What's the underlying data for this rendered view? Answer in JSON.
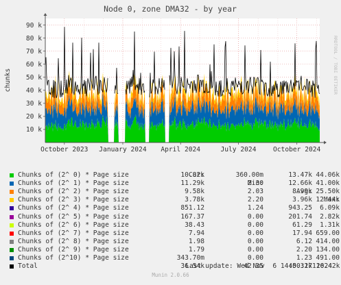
{
  "title": "Node 0, zone DMA32 - by year",
  "side_label": "RRDTOOL / TOBI OETIKER",
  "munin_version": "Munin 2.0.66",
  "colors": {
    "background": "#f0f0f0",
    "plot_bg": "#ffffff",
    "grid": "#e8a0a0",
    "axis": "#555555"
  },
  "legend": {
    "headers": {
      "cur": "Cur:",
      "min": "Min:",
      "avg": "Avg:",
      "max": "Max:"
    },
    "rows": [
      {
        "label": "Chunks of (2^ 0) * Page size",
        "color": "#00cc00",
        "cur": "10.82k",
        "min": "360.00m",
        "avg": "13.47k",
        "max": "44.06k"
      },
      {
        "label": "Chunks of (2^ 1) * Page size",
        "color": "#0066b3",
        "cur": "11.29k",
        "min": "2.30",
        "avg": "12.66k",
        "max": "41.00k"
      },
      {
        "label": "Chunks of (2^ 2) * Page size",
        "color": "#ff8000",
        "cur": "9.58k",
        "min": "2.03",
        "avg": "8.99k",
        "max": "25.50k"
      },
      {
        "label": "Chunks of (2^ 3) * Page size",
        "color": "#ffcc00",
        "cur": "3.78k",
        "min": "2.20",
        "avg": "3.96k",
        "max": "12.44k"
      },
      {
        "label": "Chunks of (2^ 4) * Page size",
        "color": "#330099",
        "cur": "851.12",
        "min": "1.24",
        "avg": "943.25",
        "max": "6.09k"
      },
      {
        "label": "Chunks of (2^ 5) * Page size",
        "color": "#990099",
        "cur": "167.37",
        "min": "0.00",
        "avg": "201.74",
        "max": "2.82k"
      },
      {
        "label": "Chunks of (2^ 6) * Page size",
        "color": "#ccff00",
        "cur": "38.43",
        "min": "0.00",
        "avg": "61.29",
        "max": "1.31k"
      },
      {
        "label": "Chunks of (2^ 7) * Page size",
        "color": "#ff0000",
        "cur": "7.94",
        "min": "0.00",
        "avg": "17.94",
        "max": "659.00"
      },
      {
        "label": "Chunks of (2^ 8) * Page size",
        "color": "#808080",
        "cur": "1.98",
        "min": "0.00",
        "avg": "6.12",
        "max": "414.00"
      },
      {
        "label": "Chunks of (2^ 9) * Page size",
        "color": "#008f00",
        "cur": "1.79",
        "min": "0.00",
        "avg": "2.20",
        "max": "134.00"
      },
      {
        "label": "Chunks of (2^10) * Page size",
        "color": "#00487d",
        "cur": "343.70m",
        "min": "0.00",
        "avg": "1.23",
        "max": "491.00"
      },
      {
        "label": "Total",
        "color": "#000000",
        "cur": "36.54k",
        "min": "42.35",
        "avg": "40.32k",
        "max": "116.42k"
      }
    ]
  },
  "last_update": "Last update: Wed Nov  6 14:50:17 2024",
  "chart_data": {
    "type": "area",
    "title": "Node 0, zone DMA32 - by year",
    "ylabel": "chunks",
    "ylim": [
      0,
      95000
    ],
    "y_ticks": [
      10000,
      20000,
      30000,
      40000,
      50000,
      60000,
      70000,
      80000,
      90000
    ],
    "y_tick_labels": [
      "10 k",
      "20 k",
      "30 k",
      "40 k",
      "50 k",
      "60 k",
      "70 k",
      "80 k",
      "90 k"
    ],
    "x_tick_labels": [
      "October 2023",
      "January 2024",
      "April 2024",
      "July 2024",
      "October 2024"
    ],
    "x_tick_dates": [
      "2023-10-01",
      "2024-01-01",
      "2024-04-01",
      "2024-07-01",
      "2024-10-01"
    ],
    "xlim": [
      "2023-09-01",
      "2024-11-06"
    ],
    "grid": true,
    "stacked": true,
    "series": [
      {
        "name": "Chunks of (2^ 0) * Page size",
        "x": [
          "2023-09-01",
          "2023-09-20",
          "2023-10-10",
          "2023-10-30",
          "2023-11-19",
          "2023-12-09",
          "2023-12-29",
          "2024-01-18",
          "2024-02-07",
          "2024-02-27",
          "2024-03-18",
          "2024-04-07",
          "2024-04-27",
          "2024-05-17",
          "2024-06-06",
          "2024-06-26",
          "2024-07-16",
          "2024-08-05",
          "2024-08-25",
          "2024-09-14",
          "2024-10-04",
          "2024-10-24",
          "2024-11-06"
        ],
        "y": [
          14000,
          12000,
          15000,
          13000,
          14500,
          16000,
          13000,
          15000,
          12500,
          14000,
          15500,
          14000,
          16000,
          15000,
          13500,
          14000,
          15500,
          14500,
          13000,
          14000,
          15000,
          13500,
          10820
        ]
      },
      {
        "name": "Chunks of (2^ 1) * Page size",
        "x": [
          "2023-09-01",
          "2023-09-20",
          "2023-10-10",
          "2023-10-30",
          "2023-11-19",
          "2023-12-09",
          "2023-12-29",
          "2024-01-18",
          "2024-02-07",
          "2024-02-27",
          "2024-03-18",
          "2024-04-07",
          "2024-04-27",
          "2024-05-17",
          "2024-06-06",
          "2024-06-26",
          "2024-07-16",
          "2024-08-05",
          "2024-08-25",
          "2024-09-14",
          "2024-10-04",
          "2024-10-24",
          "2024-11-06"
        ],
        "y": [
          13000,
          12500,
          13500,
          12000,
          13000,
          12500,
          11500,
          13000,
          12000,
          12500,
          13000,
          12500,
          13000,
          12000,
          12500,
          13000,
          12500,
          13000,
          12000,
          12500,
          13000,
          12000,
          11290
        ]
      },
      {
        "name": "Chunks of (2^ 2) * Page size",
        "x": [
          "2023-09-01",
          "2023-09-20",
          "2023-10-10",
          "2023-10-30",
          "2023-11-19",
          "2023-12-09",
          "2023-12-29",
          "2024-01-18",
          "2024-02-07",
          "2024-02-27",
          "2024-03-18",
          "2024-04-07",
          "2024-04-27",
          "2024-05-17",
          "2024-06-06",
          "2024-06-26",
          "2024-07-16",
          "2024-08-05",
          "2024-08-25",
          "2024-09-14",
          "2024-10-04",
          "2024-10-24",
          "2024-11-06"
        ],
        "y": [
          9000,
          8500,
          9500,
          8800,
          9000,
          8500,
          8000,
          9200,
          8600,
          9000,
          9400,
          9000,
          9300,
          8800,
          9000,
          9100,
          9200,
          8900,
          8700,
          9000,
          9300,
          8800,
          9580
        ]
      },
      {
        "name": "Chunks of (2^ 3) * Page size",
        "x": [
          "2023-09-01",
          "2023-09-20",
          "2023-10-10",
          "2023-10-30",
          "2023-11-19",
          "2023-12-09",
          "2023-12-29",
          "2024-01-18",
          "2024-02-07",
          "2024-02-27",
          "2024-03-18",
          "2024-04-07",
          "2024-04-27",
          "2024-05-17",
          "2024-06-06",
          "2024-06-26",
          "2024-07-16",
          "2024-08-05",
          "2024-08-25",
          "2024-09-14",
          "2024-10-04",
          "2024-10-24",
          "2024-11-06"
        ],
        "y": [
          4000,
          3800,
          4100,
          3900,
          4000,
          3700,
          3600,
          4000,
          3800,
          4000,
          4200,
          4000,
          4100,
          3900,
          4000,
          4000,
          4100,
          3900,
          3800,
          4000,
          4100,
          3900,
          3780
        ]
      }
    ],
    "total_series": {
      "name": "Total",
      "x": [
        "2023-09-01",
        "2023-09-20",
        "2023-10-10",
        "2023-10-30",
        "2023-11-19",
        "2023-12-09",
        "2023-12-29",
        "2024-01-18",
        "2024-02-07",
        "2024-02-27",
        "2024-03-18",
        "2024-04-07",
        "2024-04-27",
        "2024-05-17",
        "2024-06-06",
        "2024-06-26",
        "2024-07-16",
        "2024-08-05",
        "2024-08-25",
        "2024-09-14",
        "2024-10-04",
        "2024-10-24",
        "2024-11-06"
      ],
      "y": [
        42000,
        39000,
        44000,
        40000,
        42500,
        43000,
        38000,
        43000,
        40000,
        41500,
        44000,
        42000,
        44500,
        42000,
        41000,
        42000,
        44000,
        42500,
        39500,
        41500,
        43500,
        40500,
        36540
      ]
    },
    "gaps": [
      [
        "2023-12-09",
        "2023-12-19"
      ],
      [
        "2023-12-25",
        "2024-01-05"
      ],
      [
        "2024-02-05",
        "2024-02-12"
      ],
      [
        "2024-03-08",
        "2024-03-14"
      ]
    ]
  }
}
